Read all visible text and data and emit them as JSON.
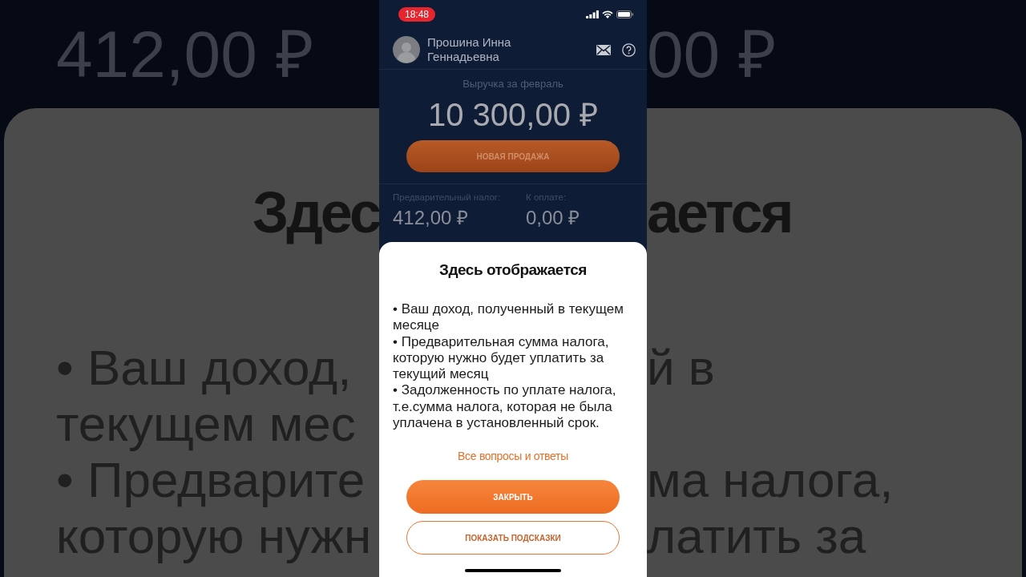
{
  "background": {
    "rows": [
      {
        "kind": "amount",
        "left": "412,00 ₽",
        "right": "00 ₽"
      },
      {
        "kind": "title",
        "left": "Здес",
        "right": "ается"
      },
      {
        "kind": "text",
        "left": "• Ваш доход,",
        "right": "й в"
      },
      {
        "kind": "text",
        "left": "текущем мес"
      },
      {
        "kind": "text",
        "left": "• Предварите",
        "right": "ма налога,"
      },
      {
        "kind": "text",
        "left": "которую нужн",
        "right": "латить за"
      }
    ]
  },
  "status_bar": {
    "time": "18:48"
  },
  "profile": {
    "name": "Прошина Инна Геннадьевна"
  },
  "revenue": {
    "label": "Выручка за февраль",
    "amount": "10 300,00 ₽"
  },
  "new_sale_button": "НОВАЯ ПРОДАЖА",
  "summary": [
    {
      "label": "Предварительный налог:",
      "value": "412,00 ₽"
    },
    {
      "label": "К оплате:",
      "value": "0,00 ₽"
    }
  ],
  "sheet": {
    "title": "Здесь отображается",
    "items": [
      "• Ваш доход, полученный в текущем месяце",
      "• Предварительная сумма налога, которую нужно будет уплатить за текущий месяц",
      "• Задолженность по уплате налога, т.е.сумма налога, которая не была уплачена в установленный срок."
    ],
    "link": "Все вопросы и ответы",
    "buttons": [
      {
        "label": "ЗАКРЫТЬ",
        "kind": "primary"
      },
      {
        "label": "ПОКАЗАТЬ ПОДСКАЗКИ",
        "kind": "outline"
      }
    ]
  }
}
